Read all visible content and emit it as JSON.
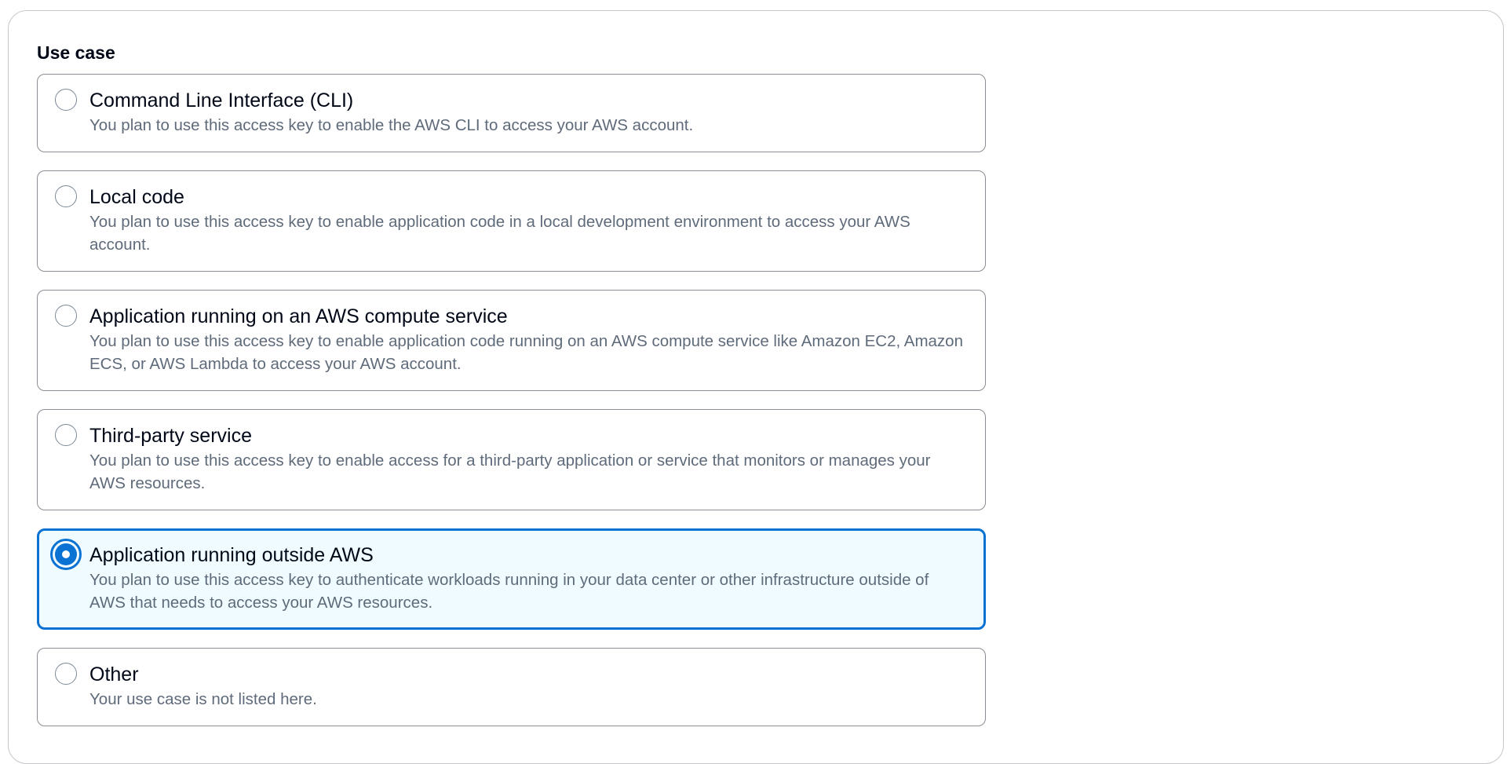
{
  "section": {
    "label": "Use case"
  },
  "options": [
    {
      "title": "Command Line Interface (CLI)",
      "description": "You plan to use this access key to enable the AWS CLI to access your AWS account.",
      "selected": false
    },
    {
      "title": "Local code",
      "description": "You plan to use this access key to enable application code in a local development environment to access your AWS account.",
      "selected": false
    },
    {
      "title": "Application running on an AWS compute service",
      "description": "You plan to use this access key to enable application code running on an AWS compute service like Amazon EC2, Amazon ECS, or AWS Lambda to access your AWS account.",
      "selected": false
    },
    {
      "title": "Third-party service",
      "description": "You plan to use this access key to enable access for a third-party application or service that monitors or manages your AWS resources.",
      "selected": false
    },
    {
      "title": "Application running outside AWS",
      "description": "You plan to use this access key to authenticate workloads running in your data center or other infrastructure outside of AWS that needs to access your AWS resources.",
      "selected": true
    },
    {
      "title": "Other",
      "description": "Your use case is not listed here.",
      "selected": false
    }
  ],
  "colors": {
    "accent": "#0972d3",
    "selected_background": "#f0fbff",
    "border": "#8c8c94",
    "description_text": "#5f6b7a"
  }
}
